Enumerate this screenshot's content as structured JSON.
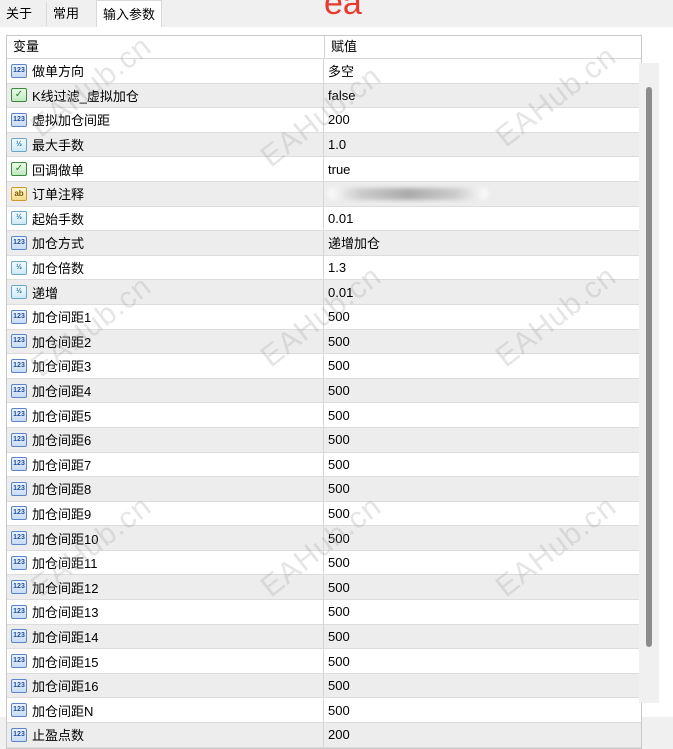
{
  "tabs": [
    "关于",
    "常用",
    "输入参数"
  ],
  "brand": "ea",
  "watermark": "EAHub.cn",
  "columns": {
    "name": "变量",
    "value": "赋值"
  },
  "rows": [
    {
      "icon": "int",
      "name": "做单方向",
      "value": "多空"
    },
    {
      "icon": "bool",
      "name": "K线过滤_虚拟加仓",
      "value": "false"
    },
    {
      "icon": "int",
      "name": "虚拟加仓间距",
      "value": "200"
    },
    {
      "icon": "float",
      "name": "最大手数",
      "value": "1.0"
    },
    {
      "icon": "bool",
      "name": "回调做单",
      "value": "true"
    },
    {
      "icon": "string",
      "name": "订单注释",
      "value": ""
    },
    {
      "icon": "float",
      "name": "起始手数",
      "value": "0.01"
    },
    {
      "icon": "int",
      "name": "加仓方式",
      "value": "递增加仓"
    },
    {
      "icon": "float",
      "name": "加仓倍数",
      "value": "1.3"
    },
    {
      "icon": "float",
      "name": "递增",
      "value": "0.01"
    },
    {
      "icon": "int",
      "name": "加仓间距1",
      "value": "500"
    },
    {
      "icon": "int",
      "name": "加仓间距2",
      "value": "500"
    },
    {
      "icon": "int",
      "name": "加仓间距3",
      "value": "500"
    },
    {
      "icon": "int",
      "name": "加仓间距4",
      "value": "500"
    },
    {
      "icon": "int",
      "name": "加仓间距5",
      "value": "500"
    },
    {
      "icon": "int",
      "name": "加仓间距6",
      "value": "500"
    },
    {
      "icon": "int",
      "name": "加仓间距7",
      "value": "500"
    },
    {
      "icon": "int",
      "name": "加仓间距8",
      "value": "500"
    },
    {
      "icon": "int",
      "name": "加仓间距9",
      "value": "500"
    },
    {
      "icon": "int",
      "name": "加仓间距10",
      "value": "500"
    },
    {
      "icon": "int",
      "name": "加仓间距11",
      "value": "500"
    },
    {
      "icon": "int",
      "name": "加仓间距12",
      "value": "500"
    },
    {
      "icon": "int",
      "name": "加仓间距13",
      "value": "500"
    },
    {
      "icon": "int",
      "name": "加仓间距14",
      "value": "500"
    },
    {
      "icon": "int",
      "name": "加仓间距15",
      "value": "500"
    },
    {
      "icon": "int",
      "name": "加仓间距16",
      "value": "500"
    },
    {
      "icon": "int",
      "name": "加仓间距N",
      "value": "500"
    },
    {
      "icon": "int",
      "name": "止盈点数",
      "value": "200"
    }
  ],
  "icon_glyphs": {
    "int": "123",
    "float": "½",
    "bool": "✓",
    "string": "ab"
  }
}
